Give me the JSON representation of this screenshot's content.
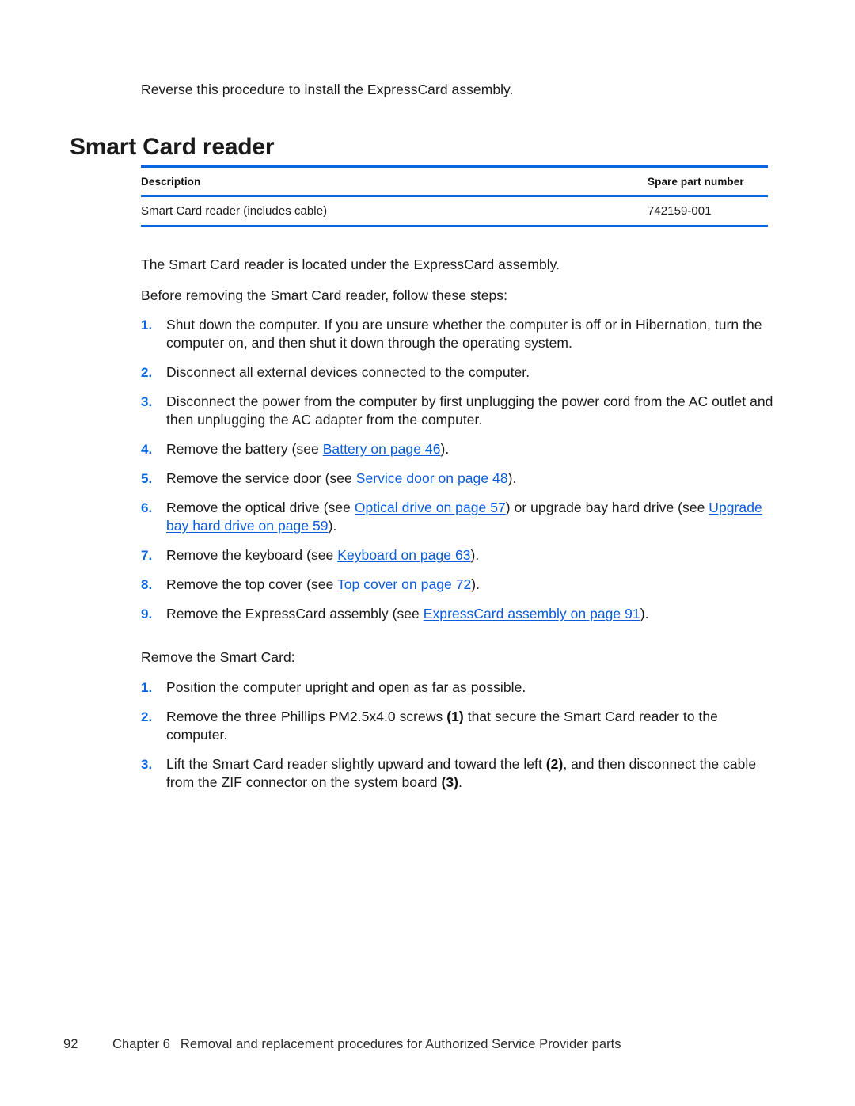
{
  "document": {
    "intro_line": "Reverse this procedure to install the ExpressCard assembly.",
    "section_heading": "Smart Card reader",
    "heading_color": "#0a66e0",
    "link_color": "#0a5cdb",
    "rule_color": "#0a66e0"
  },
  "parts_table": {
    "columns": [
      "Description",
      "Spare part number"
    ],
    "rows": [
      {
        "description": "Smart Card reader (includes cable)",
        "spare_part_number": "742159-001"
      }
    ]
  },
  "paragraphs": {
    "located": "The Smart Card reader is located under the ExpressCard assembly.",
    "before_removing": "Before removing the Smart Card reader, follow these steps:",
    "remove_smart_card": "Remove the Smart Card:"
  },
  "prerequisite_steps": [
    {
      "number": "1.",
      "parts": [
        {
          "type": "text",
          "text": "Shut down the computer. If you are unsure whether the computer is off or in Hibernation, turn the computer on, and then shut it down through the operating system."
        }
      ]
    },
    {
      "number": "2.",
      "parts": [
        {
          "type": "text",
          "text": "Disconnect all external devices connected to the computer."
        }
      ]
    },
    {
      "number": "3.",
      "parts": [
        {
          "type": "text",
          "text": "Disconnect the power from the computer by first unplugging the power cord from the AC outlet and then unplugging the AC adapter from the computer."
        }
      ]
    },
    {
      "number": "4.",
      "parts": [
        {
          "type": "text",
          "text": "Remove the battery (see "
        },
        {
          "type": "link",
          "text": "Battery on page 46"
        },
        {
          "type": "text",
          "text": ")."
        }
      ]
    },
    {
      "number": "5.",
      "parts": [
        {
          "type": "text",
          "text": "Remove the service door (see "
        },
        {
          "type": "link",
          "text": "Service door on page 48"
        },
        {
          "type": "text",
          "text": ")."
        }
      ]
    },
    {
      "number": "6.",
      "parts": [
        {
          "type": "text",
          "text": "Remove the optical drive (see "
        },
        {
          "type": "link",
          "text": "Optical drive on page 57"
        },
        {
          "type": "text",
          "text": ") or upgrade bay hard drive (see "
        },
        {
          "type": "link",
          "text": "Upgrade bay hard drive on page 59"
        },
        {
          "type": "text",
          "text": ")."
        }
      ]
    },
    {
      "number": "7.",
      "parts": [
        {
          "type": "text",
          "text": "Remove the keyboard (see "
        },
        {
          "type": "link",
          "text": "Keyboard on page 63"
        },
        {
          "type": "text",
          "text": ")."
        }
      ]
    },
    {
      "number": "8.",
      "parts": [
        {
          "type": "text",
          "text": "Remove the top cover (see "
        },
        {
          "type": "link",
          "text": "Top cover on page 72"
        },
        {
          "type": "text",
          "text": ")."
        }
      ]
    },
    {
      "number": "9.",
      "parts": [
        {
          "type": "text",
          "text": "Remove the ExpressCard assembly (see "
        },
        {
          "type": "link",
          "text": "ExpressCard assembly on page 91"
        },
        {
          "type": "text",
          "text": ")."
        }
      ]
    }
  ],
  "removal_steps": [
    {
      "number": "1.",
      "parts": [
        {
          "type": "text",
          "text": "Position the computer upright and open as far as possible."
        }
      ]
    },
    {
      "number": "2.",
      "parts": [
        {
          "type": "text",
          "text": "Remove the three Phillips PM2.5x4.0 screws "
        },
        {
          "type": "callout",
          "text": "(1)"
        },
        {
          "type": "text",
          "text": " that secure the Smart Card reader to the computer."
        }
      ]
    },
    {
      "number": "3.",
      "parts": [
        {
          "type": "text",
          "text": "Lift the Smart Card reader slightly upward and toward the left "
        },
        {
          "type": "callout",
          "text": "(2)"
        },
        {
          "type": "text",
          "text": ", and then disconnect the cable from the ZIF connector on the system board "
        },
        {
          "type": "callout",
          "text": "(3)"
        },
        {
          "type": "text",
          "text": "."
        }
      ]
    }
  ],
  "footer": {
    "page_number": "92",
    "chapter_label": "Chapter 6",
    "chapter_title": "Removal and replacement procedures for Authorized Service Provider parts"
  }
}
